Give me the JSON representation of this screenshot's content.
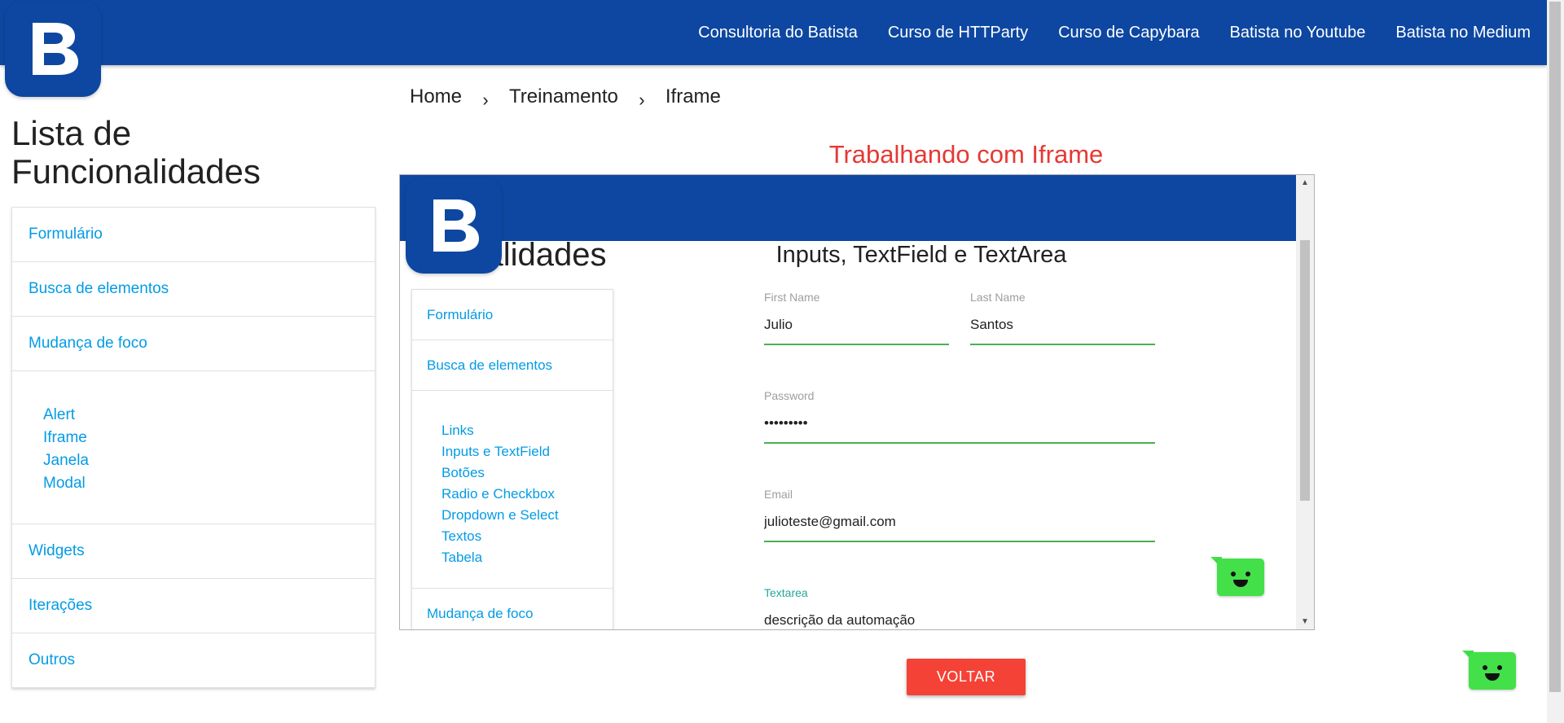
{
  "app": {
    "logo_letter": "B",
    "brand_color": "#0d47a1"
  },
  "nav": {
    "links": [
      "Consultoria do Batista",
      "Curso de HTTParty",
      "Curso de Capybara",
      "Batista no Youtube",
      "Batista no Medium"
    ]
  },
  "sidebar": {
    "title_line1": "Lista de",
    "title_line2": "Funcionalidades",
    "items": {
      "formulario": "Formulário",
      "busca": "Busca de elementos",
      "mudanca": "Mudança de foco",
      "widgets": "Widgets",
      "iteracoes": "Iterações",
      "outros": "Outros"
    },
    "subitems": [
      "Alert",
      "Iframe",
      "Janela",
      "Modal"
    ]
  },
  "breadcrumb": [
    "Home",
    "Treinamento",
    "Iframe"
  ],
  "page": {
    "title": "Trabalhando com Iframe",
    "title_color": "#e53935",
    "back_button": "VOLTAR",
    "back_button_color": "#f44336"
  },
  "iframe": {
    "side_title_visible": "onalidades",
    "menu": {
      "formulario": "Formulário",
      "busca": "Busca de elementos",
      "mudanca": "Mudança de foco"
    },
    "submenu": [
      "Links",
      "Inputs e TextField",
      "Botões",
      "Radio e Checkbox",
      "Dropdown e Select",
      "Textos",
      "Tabela"
    ],
    "form": {
      "title": "Inputs, TextField e TextArea",
      "first_name": {
        "label": "First Name",
        "value": "Julio"
      },
      "last_name": {
        "label": "Last Name",
        "value": "Santos"
      },
      "password": {
        "label": "Password",
        "value": "•••••••••"
      },
      "email": {
        "label": "Email",
        "value": "julioteste@gmail.com"
      },
      "textarea": {
        "label": "Textarea",
        "value": "descrição da automação"
      }
    }
  },
  "widgets": {
    "chat_bot_color": "#43e04a",
    "chat_bot_icon": "smiley-chat-icon"
  }
}
